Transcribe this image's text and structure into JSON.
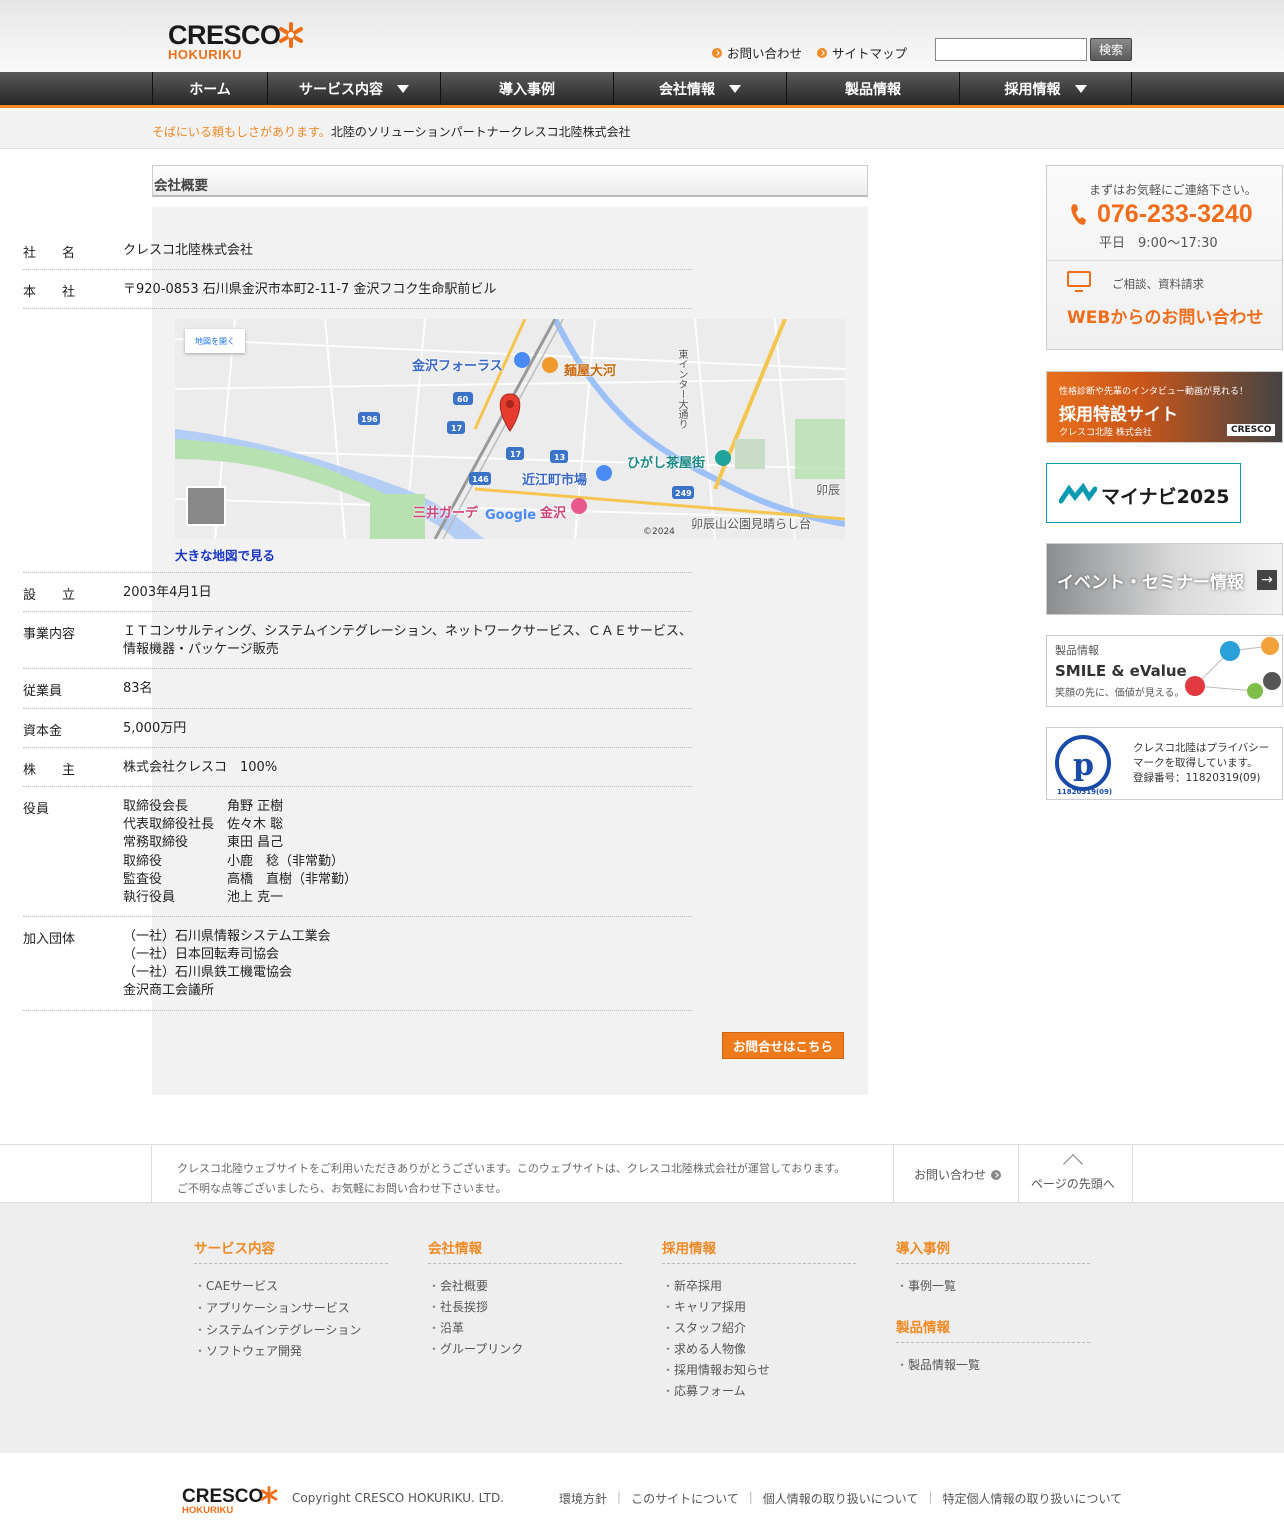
{
  "header": {
    "logo_main": "CRESCO",
    "logo_sub": "HOKURIKU",
    "links": [
      "お問い合わせ",
      "サイトマップ"
    ],
    "search_placeholder": "",
    "search_button": "検索"
  },
  "nav": [
    {
      "label": "ホーム",
      "dropdown": false
    },
    {
      "label": "サービス内容",
      "dropdown": true
    },
    {
      "label": "導入事例",
      "dropdown": false
    },
    {
      "label": "会社情報",
      "dropdown": true
    },
    {
      "label": "製品情報",
      "dropdown": false
    },
    {
      "label": "採用情報",
      "dropdown": true
    }
  ],
  "tagline": {
    "accent": "そばにいる頼もしさがあります。",
    "text": "北陸のソリューションパートナークレスコ北陸株式会社"
  },
  "section_title": "会社概要",
  "company": {
    "name_label": "社　　名",
    "name": "クレスコ北陸株式会社",
    "hq_label": "本　　社",
    "hq": "〒920-0853 石川県金沢市本町2-11-7 金沢フコク生命駅前ビル",
    "map_open_label": "地図を開く",
    "map_labels": [
      "金沢フォーラス",
      "麺屋大河",
      "近江町市場",
      "ひがし茶屋街",
      "三井ガーデ",
      "金沢",
      "東インター大通り",
      "卯辰",
      "卯辰山公園見晴らし台"
    ],
    "map_route_numbers": [
      "60",
      "196",
      "17",
      "13",
      "17",
      "146",
      "249"
    ],
    "map_copyright": "©2024",
    "map_google": "Google",
    "bigger_map": "大きな地図で見る",
    "founded_label": "設　　立",
    "founded": "2003年4月1日",
    "business_label": "事業内容",
    "business": "ＩＴコンサルティング、システムインテグレーション、ネットワークサービス、ＣＡＥサービス、\n情報機器・パッケージ販売",
    "employees_label": "従業員",
    "employees": "83名",
    "capital_label": "資本金",
    "capital": "5,000万円",
    "shareholder_label": "株　　主",
    "shareholder": "株式会社クレスコ　100%",
    "officers_label": "役員",
    "officers": [
      {
        "title": "取締役会長",
        "name": "角野 正樹"
      },
      {
        "title": "代表取締役社長",
        "name": "佐々木 聡"
      },
      {
        "title": "常務取締役",
        "name": "東田 昌己"
      },
      {
        "title": "取締役",
        "name": "小鹿　稔（非常勤）"
      },
      {
        "title": "監査役",
        "name": "高橋　直樹（非常勤）"
      },
      {
        "title": "執行役員",
        "name": "池上 克一"
      }
    ],
    "orgs_label": "加入団体",
    "orgs": "（一社）石川県情報システム工業会\n（一社）日本回転寿司協会\n（一社）石川県鉄工機電協会\n金沢商工会議所",
    "cta": "お問合せはこちら"
  },
  "sidebar": {
    "contact_intro": "まずはお気軽にご連絡下さい。",
    "phone": "076-233-3240",
    "hours": "平日　9:00〜17:30",
    "web_intro": "ご相談、資料請求",
    "web_cta": "WEBからのお問い合わせ",
    "recruit_sub": "性格診断や先輩のインタビュー動画が見れる！",
    "recruit_title": "採用特設サイト",
    "recruit_company": "クレスコ北陸 株式会社",
    "recruit_logo": "CRESCO",
    "mynavi": "マイナビ2025",
    "event": "イベント・セミナー情報",
    "product_label": "製品情報",
    "product_title": "SMILE & eValue",
    "product_sub": "笑顔の先に、価値が見える。",
    "privacy_text": "クレスコ北陸はプライバシー\nマークを取得しています。\n登録番号：11820319(09)",
    "privacy_mark": "11820319(09)"
  },
  "footer_msg": {
    "text": "クレスコ北陸ウェブサイトをご利用いただきありがとうございます。このウェブサイトは、クレスコ北陸株式会社が運営しております。\nご不明な点等ございましたら、お気軽にお問い合わせ下さいませ。",
    "inquiry": "お問い合わせ",
    "page_top": "ページの先頭へ"
  },
  "footer_nav": [
    {
      "title": "サービス内容",
      "items": [
        "CAEサービス",
        "アプリケーションサービス",
        "システムインテグレーション",
        "ソフトウェア開発"
      ]
    },
    {
      "title": "会社情報",
      "items": [
        "会社概要",
        "社長挨拶",
        "沿革",
        "グループリンク"
      ]
    },
    {
      "title": "採用情報",
      "items": [
        "新卒採用",
        "キャリア採用",
        "スタッフ紹介",
        "求める人物像",
        "採用情報お知らせ",
        "応募フォーム"
      ]
    },
    {
      "title": "導入事例",
      "items": [
        "事例一覧"
      ]
    },
    {
      "title": "製品情報",
      "items": [
        "製品情報一覧"
      ]
    }
  ],
  "footer_bottom": {
    "copyright": "Copyright CRESCO HOKURIKU. LTD.",
    "links": [
      "環境方針",
      "このサイトについて",
      "個人情報の取り扱いについて",
      "特定個人情報の取り扱いについて"
    ]
  },
  "colors": {
    "accent": "#f08a24",
    "nav_dark": "#2a2a2a",
    "link_blue": "#1a35c8"
  }
}
